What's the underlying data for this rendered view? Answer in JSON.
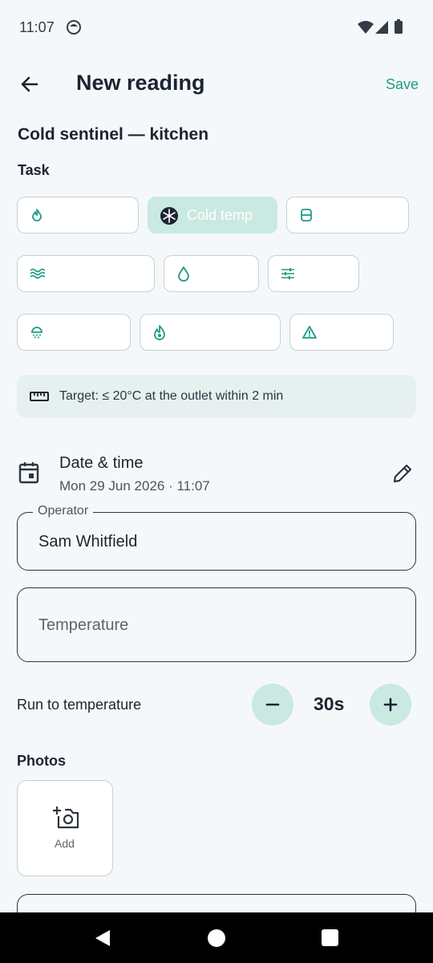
{
  "status": {
    "time": "11:07"
  },
  "header": {
    "title": "New reading",
    "save_label": "Save",
    "back_icon": "arrow-left-icon"
  },
  "asset_title": "Cold sentinel — kitchen",
  "task": {
    "label": "Task",
    "chips": [
      {
        "icon": "flame-icon",
        "label": ""
      },
      {
        "icon": "snowflake-icon",
        "label": "Cold temp",
        "selected": true
      },
      {
        "icon": "tank-icon",
        "label": ""
      },
      {
        "icon": "waves-icon",
        "label": ""
      },
      {
        "icon": "droplet-icon",
        "label": ""
      },
      {
        "icon": "sliders-icon",
        "label": ""
      },
      {
        "icon": "shower-icon",
        "label": ""
      },
      {
        "icon": "fire-drop-icon",
        "label": ""
      },
      {
        "icon": "warning-icon",
        "label": ""
      }
    ]
  },
  "target": {
    "text": "Target: ≤ 20°C at the outlet within 2 min"
  },
  "datetime": {
    "title": "Date & time",
    "value": "Mon 29 Jun 2026 · 11:07"
  },
  "operator": {
    "label": "Operator",
    "value": "Sam Whitfield"
  },
  "temperature": {
    "placeholder": "Temperature"
  },
  "run": {
    "label": "Run to temperature",
    "value": "30s"
  },
  "photos": {
    "label": "Photos",
    "add_label": "Add"
  },
  "colors": {
    "accent": "#1e9c84",
    "chip_selected": "#c9e9e1",
    "info_bg": "#e6f0ef"
  }
}
